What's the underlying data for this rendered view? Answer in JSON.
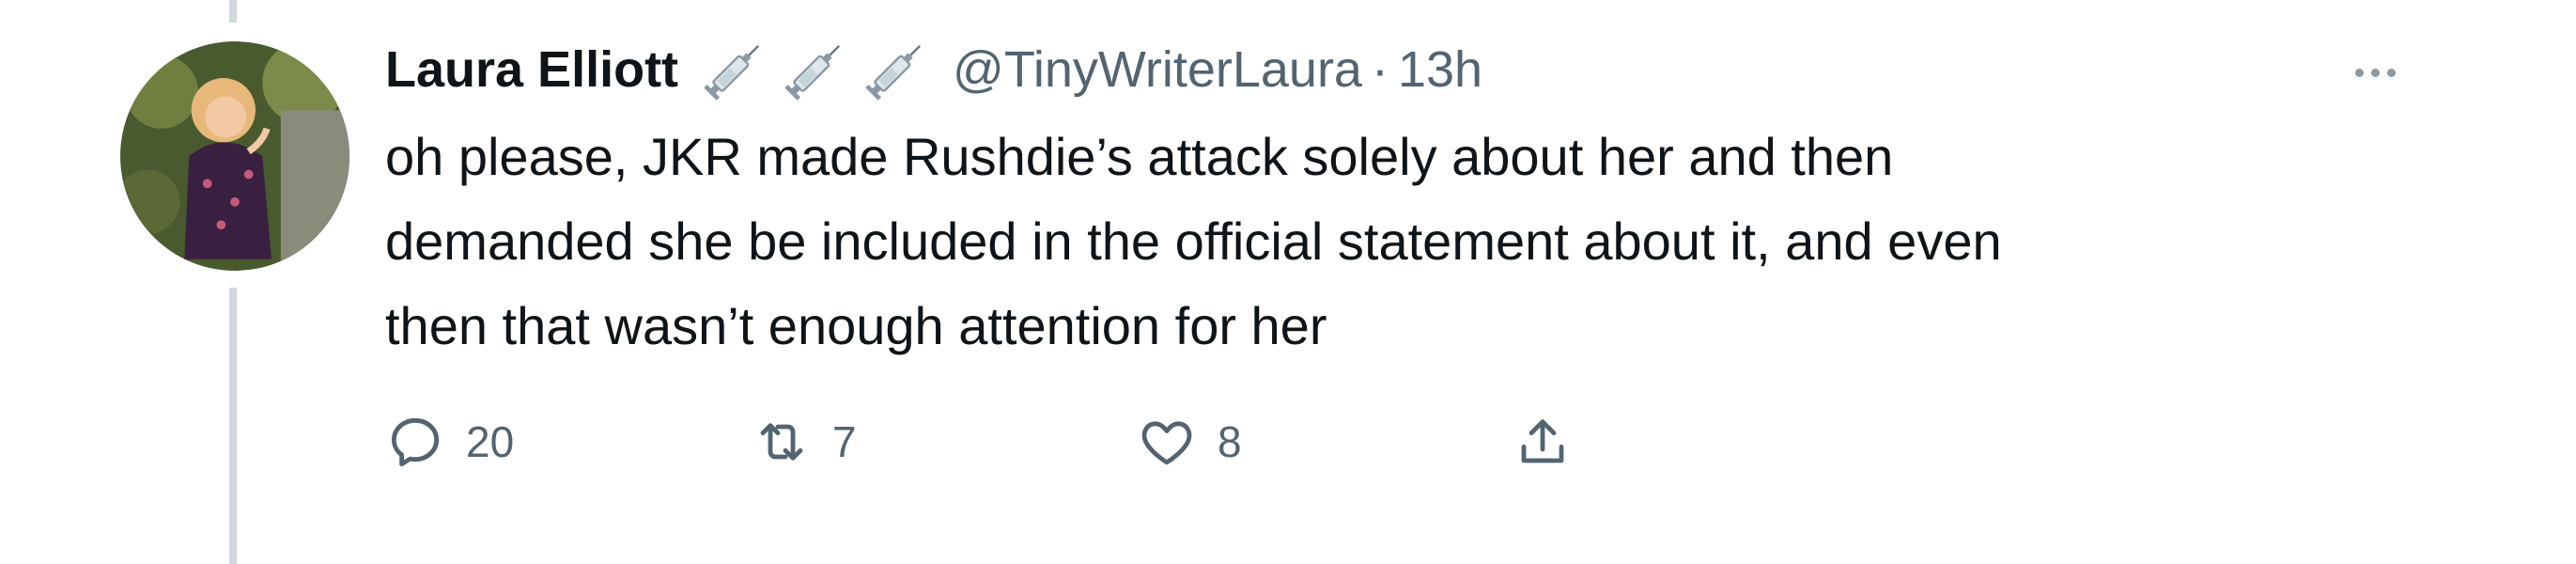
{
  "tweet": {
    "display_name": "Laura Elliott",
    "badge_emojis": [
      "syringe-icon",
      "syringe-icon",
      "syringe-icon"
    ],
    "handle": "@TinyWriterLaura",
    "separator": "·",
    "timestamp": "13h",
    "text_lines": [
      "oh please, JKR made Rushdie’s attack solely about her and then",
      "demanded she be included in the official statement about it, and even",
      "then that wasn’t enough attention for her"
    ],
    "actions": {
      "reply_count": "20",
      "retweet_count": "7",
      "like_count": "8",
      "share_count": ""
    }
  },
  "colors": {
    "text_primary": "#0f1419",
    "text_secondary": "#536471",
    "thread_line": "#cfd9de"
  }
}
